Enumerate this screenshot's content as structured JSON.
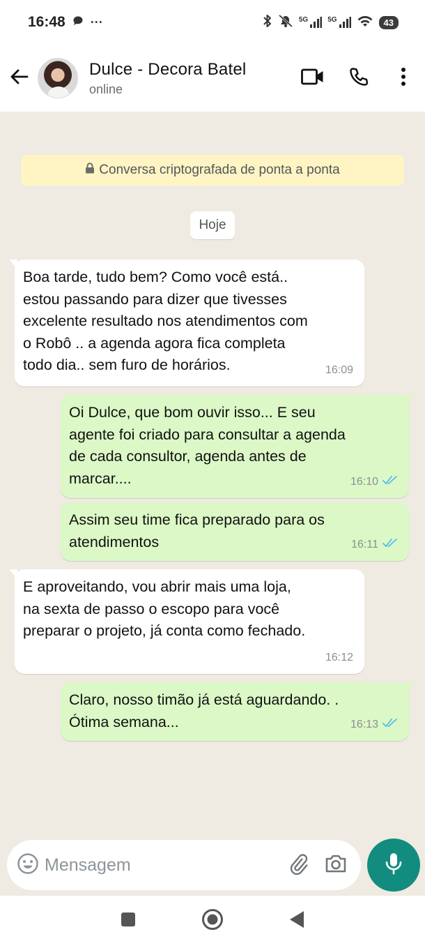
{
  "status_bar": {
    "time": "16:48",
    "dots": "···",
    "network_1": "5G",
    "network_2": "5G",
    "battery": "43"
  },
  "header": {
    "contact_name": "Dulce - Decora Batel",
    "contact_status": "online",
    "icons": [
      "back-arrow-icon",
      "video-call-icon",
      "phone-icon",
      "more-icon"
    ]
  },
  "chat": {
    "encryption_notice": "Conversa criptografada de ponta a ponta",
    "date_label": "Hoje",
    "messages": [
      {
        "direction": "in",
        "text": "Boa tarde, tudo bem? Como você está..\nestou passando para dizer que tivesses\nexcelente resultado nos atendimentos com\no Robô .. a agenda agora fica completa\ntodo dia.. sem furo de horários.",
        "time": "16:09"
      },
      {
        "direction": "out",
        "text": "Oi Dulce, que bom ouvir isso... E seu\nagente foi criado para consultar a agenda\nde cada consultor,  agenda antes de\nmarcar....",
        "time": "16:10",
        "read": true
      },
      {
        "direction": "out",
        "text": "Assim seu time fica preparado para os\natendimentos",
        "time": "16:11",
        "read": true
      },
      {
        "direction": "in",
        "text": "E aproveitando, vou abrir mais uma loja,\nna sexta de passo o escopo para você\npreparar o projeto, já conta como fechado.",
        "time": "16:12"
      },
      {
        "direction": "out",
        "text": "Claro, nosso timão já está aguardando. .\nÓtima semana...",
        "time": "16:13",
        "read": true
      }
    ]
  },
  "input": {
    "placeholder": "Mensagem"
  },
  "colors": {
    "incoming_bubble": "#ffffff",
    "outgoing_bubble": "#dbf8c6",
    "read_ticks": "#53bdeb",
    "mic_button": "#128c7e",
    "chat_background": "#efeae2"
  }
}
